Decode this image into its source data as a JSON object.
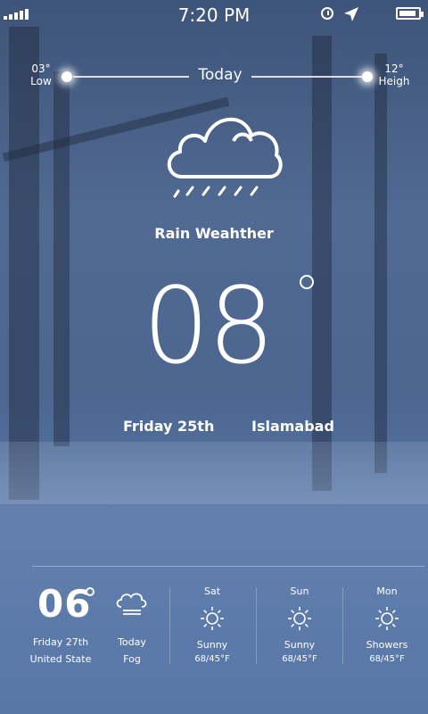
{
  "status_bar": {
    "time": "7:20 PM",
    "battery_fraction": 0.9,
    "signal_bars": 5,
    "icons": [
      "signal-icon",
      "clock-icon",
      "location-arrow-icon",
      "battery-icon"
    ]
  },
  "range": {
    "low_value": "03°",
    "low_label": "Low",
    "title": "Today",
    "high_value": "12°",
    "high_label": "Heigh"
  },
  "current": {
    "icon": "rain-cloud-icon",
    "condition": "Rain Weahther",
    "temperature": "08",
    "date": "Friday 25th",
    "city": "Islamabad"
  },
  "summary": {
    "temperature": "06",
    "date": "Friday 27th",
    "location": "United State",
    "today_label": "Today",
    "today_icon": "fog-icon",
    "today_condition": "Fog"
  },
  "forecast": [
    {
      "day": "Sat",
      "icon": "sun-icon",
      "condition": "Sunny",
      "range": "68/45°F"
    },
    {
      "day": "Sun",
      "icon": "sun-icon",
      "condition": "Sunny",
      "range": "68/45°F"
    },
    {
      "day": "Mon",
      "icon": "sun-icon",
      "condition": "Showers",
      "range": "68/45°F"
    }
  ]
}
